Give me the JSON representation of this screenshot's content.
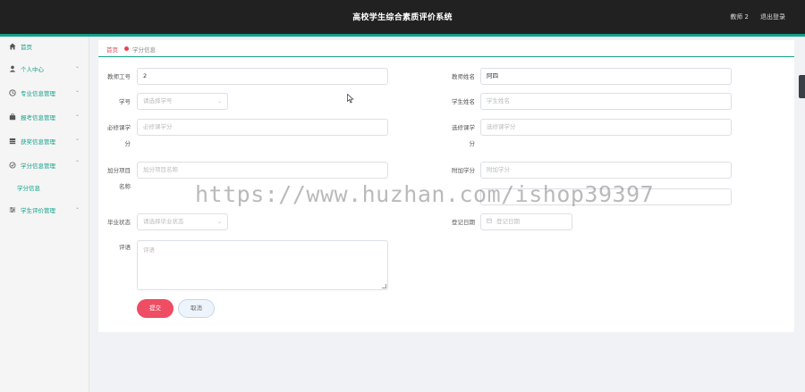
{
  "header": {
    "title": "高校学生综合素质评价系统",
    "user": "教师 2",
    "logout": "退出登录"
  },
  "colors": {
    "accent": "#12a18a",
    "header_bg": "#212121",
    "submit": "#ee4d63",
    "danger_dot": "#e8434f"
  },
  "sidebar": {
    "items": [
      {
        "label": "首页",
        "icon": "home-icon"
      },
      {
        "label": "个人中心",
        "icon": "user-icon"
      },
      {
        "label": "专业信息管理",
        "icon": "clock-icon"
      },
      {
        "label": "报考信息管理",
        "icon": "briefcase-icon"
      },
      {
        "label": "获奖信息管理",
        "icon": "trophy-icon"
      },
      {
        "label": "学分信息管理",
        "icon": "credit-icon"
      },
      {
        "label": "学分信息",
        "icon": ""
      },
      {
        "label": "学生评价管理",
        "icon": "sliders-icon"
      }
    ]
  },
  "breadcrumb": {
    "home": "首页",
    "current": "学分信息"
  },
  "form": {
    "teacher_id": {
      "label": "教师工号",
      "value": "2"
    },
    "teacher_name": {
      "label": "教师姓名",
      "value": "阿四"
    },
    "student_id": {
      "label": "学号",
      "placeholder": "请选择学号"
    },
    "student_name": {
      "label": "学生姓名",
      "placeholder": "学生姓名"
    },
    "required_credit": {
      "label_line1": "必修课学",
      "label_line2": "分",
      "placeholder": "必修课学分"
    },
    "elective_credit": {
      "label_line1": "选修课学",
      "label_line2": "分",
      "placeholder": "选修课学分"
    },
    "bonus_item": {
      "label_line1": "加分项目",
      "label_line2": "名称",
      "placeholder": "加分项目名称"
    },
    "bonus_credit": {
      "label": "附加学分",
      "placeholder": "附加学分"
    },
    "graduation_status": {
      "label": "毕业状态",
      "placeholder": "请选择毕业状态"
    },
    "register_date": {
      "label": "登记日期",
      "placeholder": "登记日期"
    },
    "comment": {
      "label": "评语",
      "placeholder": "评语"
    },
    "submit": "提交",
    "cancel": "取消"
  },
  "watermark": "https://www.huzhan.com/ishop39397"
}
